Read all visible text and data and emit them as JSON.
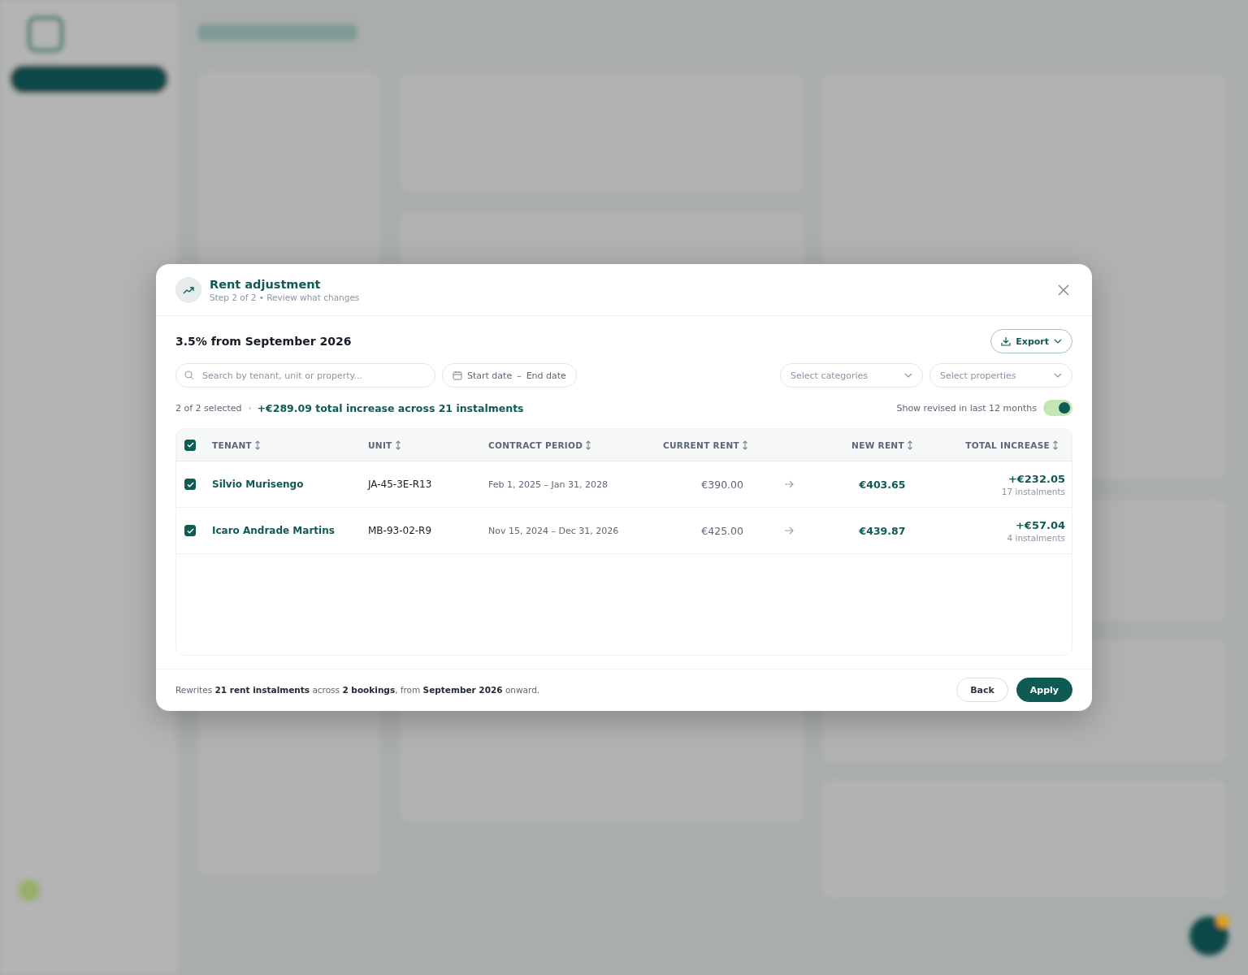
{
  "dialog": {
    "title": "Rent adjustment",
    "subtitle": "Step 2 of 2 • Review what changes"
  },
  "summary": {
    "heading": "3.5% from September 2026",
    "export_label": "Export"
  },
  "filters": {
    "search": {
      "placeholder": "Search by tenant, unit or property..."
    },
    "start_date": {
      "placeholder": "Start date"
    },
    "date_separator": "–",
    "end_date": {
      "placeholder": "End date"
    },
    "categories": {
      "placeholder": "Select categories"
    },
    "properties": {
      "placeholder": "Select properties"
    }
  },
  "selection": {
    "count": "2 of 2 selected",
    "total": "+€289.09 total increase across 21 instalments",
    "toggle_label": "Show revised in last 12 months",
    "toggle_on": true
  },
  "table": {
    "all_checked": true,
    "columns": [
      "TENANT",
      "UNIT",
      "CONTRACT PERIOD",
      "CURRENT RENT",
      "NEW RENT",
      "TOTAL INCREASE"
    ],
    "rows": [
      {
        "checked": true,
        "tenant": "Silvio Murisengo",
        "unit": "JA-45-3E-R13",
        "period": "Feb 1, 2025 – Jan 31, 2028",
        "current_rent": "€390.00",
        "new_rent": "€403.65",
        "increase": "+€232.05",
        "instalments": "17 instalments"
      },
      {
        "checked": true,
        "tenant": "Icaro Andrade Martins",
        "unit": "MB-93-02-R9",
        "period": "Nov 15, 2024 – Dec 31, 2026",
        "current_rent": "€425.00",
        "new_rent": "€439.87",
        "increase": "+€57.04",
        "instalments": "4 instalments"
      }
    ]
  },
  "footer": {
    "note": "Rewrites **21 rent instalments** across **2 bookings**, from **September 2026** onward.",
    "buttons": [
      {
        "kind": "secondary",
        "label": "Back"
      },
      {
        "kind": "primary",
        "label": "Apply"
      }
    ]
  }
}
